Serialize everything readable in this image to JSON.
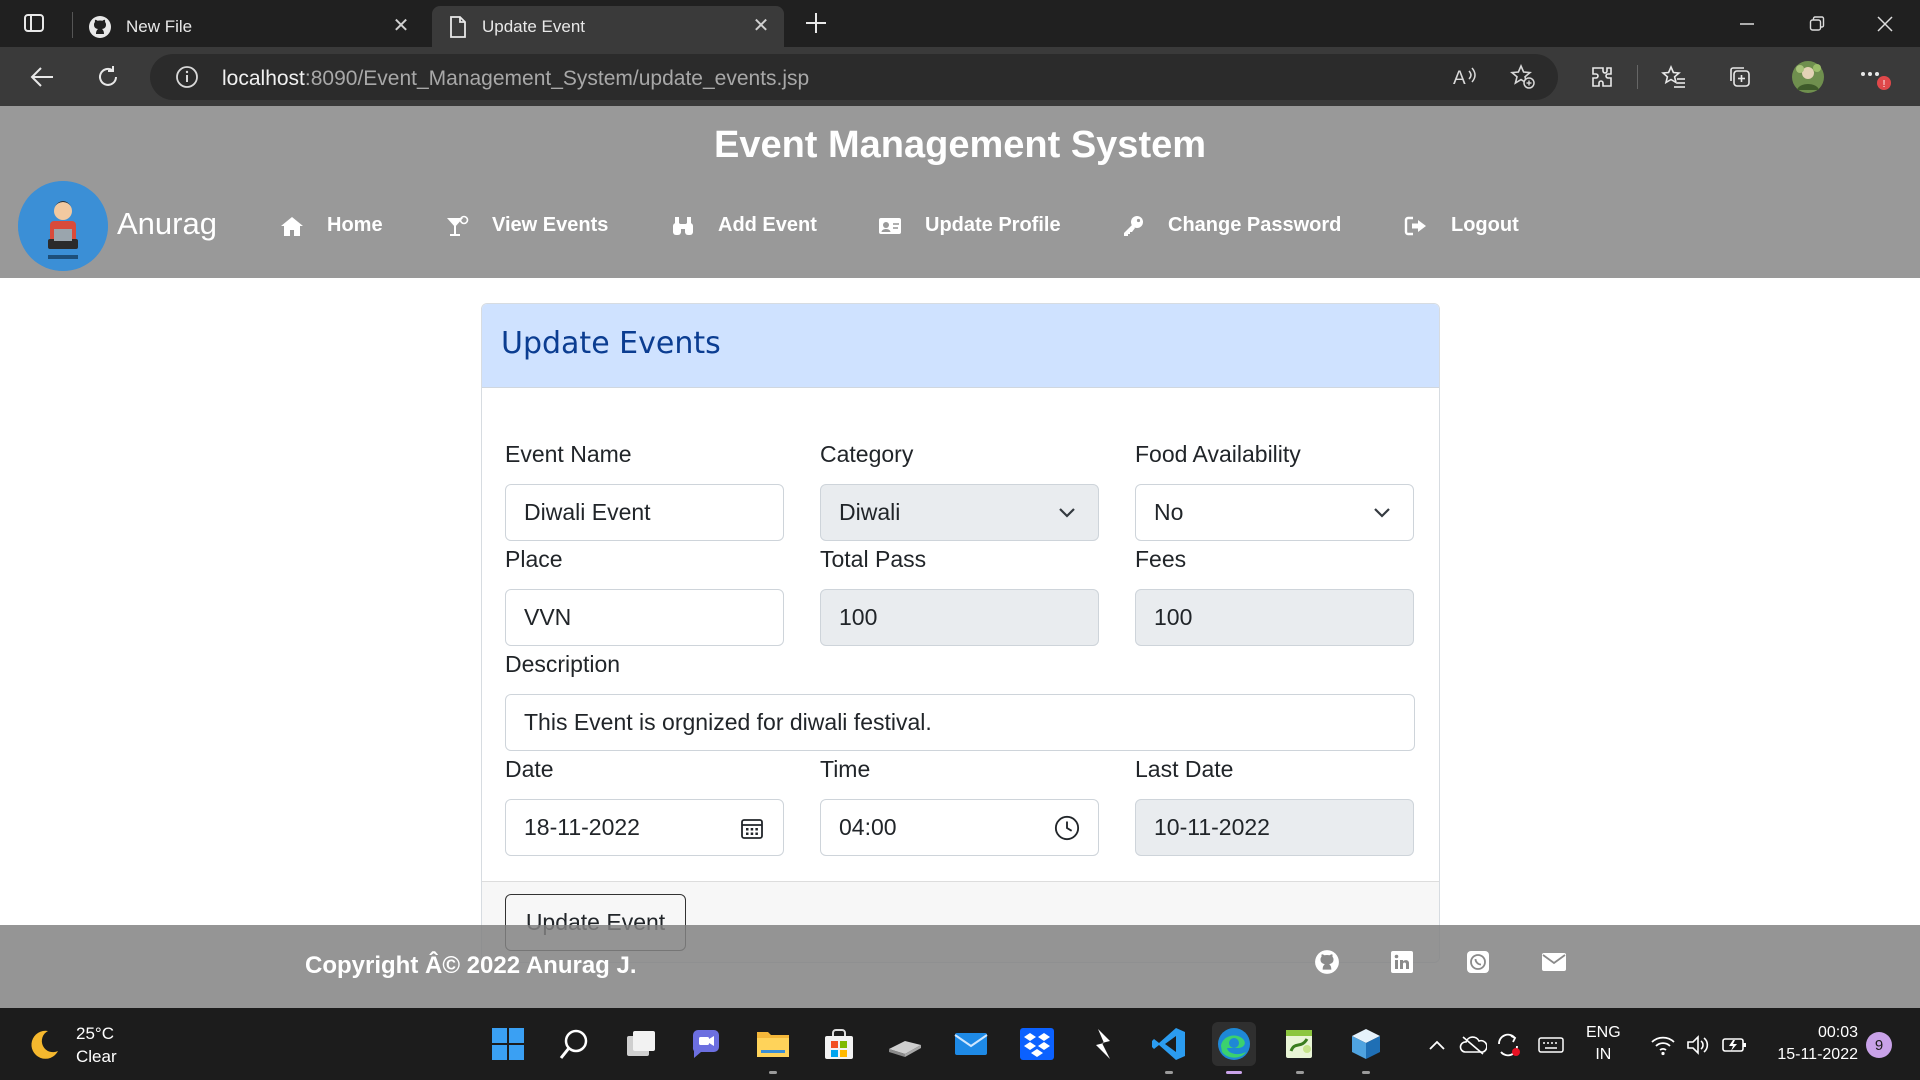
{
  "browser": {
    "tabs": [
      {
        "title": "New File"
      },
      {
        "title": "Update Event"
      }
    ],
    "url_host": "localhost",
    "url_rest": ":8090/Event_Management_System/update_events.jsp"
  },
  "header": {
    "site_title": "Event Management System",
    "brand_name": "Anurag",
    "nav": [
      {
        "label": "Home",
        "icon": "home-icon"
      },
      {
        "label": "View Events",
        "icon": "cocktail-icon"
      },
      {
        "label": "Add Event",
        "icon": "binoculars-icon"
      },
      {
        "label": "Update Profile",
        "icon": "id-card-icon"
      },
      {
        "label": "Change Password",
        "icon": "key-icon"
      },
      {
        "label": "Logout",
        "icon": "sign-out-icon"
      }
    ]
  },
  "form": {
    "heading": "Update Events",
    "fields": {
      "event_name": {
        "label": "Event Name",
        "value": "Diwali Event"
      },
      "category": {
        "label": "Category",
        "value": "Diwali"
      },
      "food": {
        "label": "Food Availability",
        "value": "No"
      },
      "place": {
        "label": "Place",
        "value": "VVN"
      },
      "total_pass": {
        "label": "Total Pass",
        "value": "100"
      },
      "fees": {
        "label": "Fees",
        "value": "100"
      },
      "description": {
        "label": "Description",
        "value": "This Event is orgnized for diwali festival."
      },
      "date": {
        "label": "Date",
        "value": "18-11-2022"
      },
      "time": {
        "label": "Time",
        "value": "04:00"
      },
      "last_date": {
        "label": "Last Date",
        "value": "10-11-2022"
      }
    },
    "submit_label": "Update Event"
  },
  "footer": {
    "copyright": "Copyright Â© 2022 Anurag J."
  },
  "taskbar": {
    "temperature": "25°C",
    "condition": "Clear",
    "lang_1": "ENG",
    "lang_2": "IN",
    "time": "00:03",
    "date": "15-11-2022",
    "notifications": "9"
  },
  "colors": {
    "header_bg": "#999999",
    "card_header_bg": "#cfe2ff",
    "card_header_text": "#0b3d91",
    "readonly_bg": "#e9ecef"
  }
}
